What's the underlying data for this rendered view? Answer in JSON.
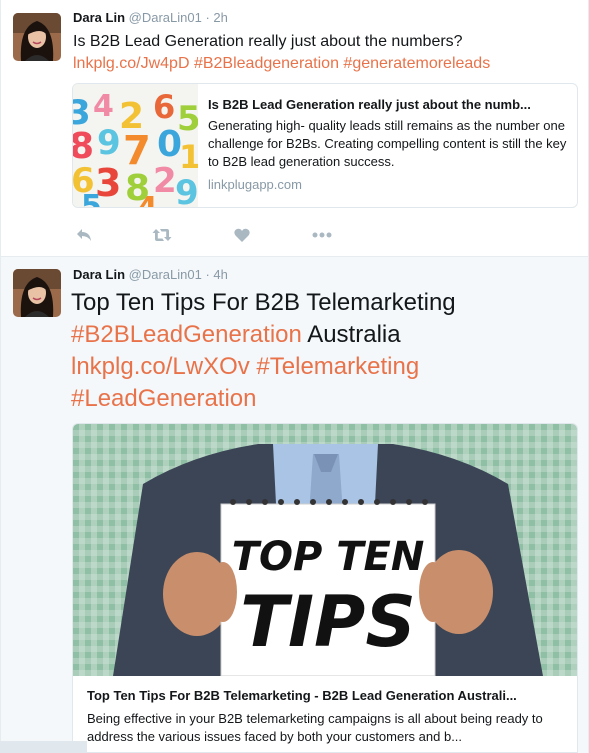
{
  "tweets": [
    {
      "author": {
        "name": "Dara Lin",
        "handle": "@DaraLin01",
        "separator": "·",
        "time": "2h"
      },
      "text": "Is B2B Lead Generation really just about the numbers?",
      "links": [
        "lnkplg.co/Jw4pD",
        "#B2Bleadgeneration",
        "#generatemoreleads"
      ],
      "card": {
        "title": "Is B2B Lead Generation really just about the numb...",
        "description": "Generating high- quality leads still remains as the number one challenge for B2Bs. Creating compelling content is still the key to B2B lead generation success.",
        "domain": "linkplugapp.com"
      },
      "actions": [
        "reply-icon",
        "retweet-icon",
        "like-icon",
        "more-icon"
      ]
    },
    {
      "author": {
        "name": "Dara Lin",
        "handle": "@DaraLin01",
        "separator": "·",
        "time": "4h"
      },
      "text_a": "Top Ten Tips For B2B Telemarketing",
      "link_a": "#B2BLeadGeneration",
      "text_b": "Australia",
      "link_b": "lnkplg.co/LwXOv",
      "link_c": "#Telemarketing",
      "link_d": "#LeadGeneration",
      "card": {
        "image_sign_line1": "TOP TEN",
        "image_sign_line2": "TIPS",
        "title": "Top Ten Tips For B2B Telemarketing - B2B Lead Generation Australi...",
        "description": "Being effective in your B2B telemarketing campaigns is all about being ready to address the various issues faced by both your customers and b..."
      }
    }
  ],
  "colors": {
    "link": "#e8734a",
    "muted": "#8899a6",
    "border": "#e1e8ed"
  }
}
